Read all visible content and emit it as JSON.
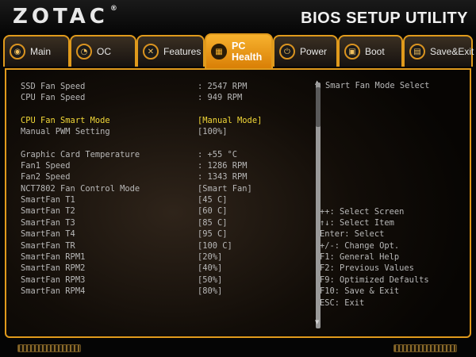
{
  "header": {
    "logo": "ZOTAC",
    "logo_mark": "®",
    "title": "BIOS SETUP UTILITY"
  },
  "tabs": [
    {
      "label": "Main",
      "icon": "circle-icon",
      "glyph": "◉"
    },
    {
      "label": "OC",
      "icon": "gauge-icon",
      "glyph": "◔"
    },
    {
      "label": "Features",
      "icon": "tools-icon",
      "glyph": "✕"
    },
    {
      "label": "PC Health",
      "icon": "chip-icon",
      "glyph": "▦",
      "active": true
    },
    {
      "label": "Power",
      "icon": "power-icon",
      "glyph": "⏻"
    },
    {
      "label": "Boot",
      "icon": "lock-icon",
      "glyph": "▣"
    },
    {
      "label": "Save&Exit",
      "icon": "save-exit-icon",
      "glyph": "▤"
    }
  ],
  "settings": [
    {
      "label": "SSD Fan Speed",
      "value": ": 2547 RPM"
    },
    {
      "label": "CPU Fan Speed",
      "value": ": 949 RPM"
    },
    {
      "label": "CPU Fan Smart Mode",
      "value": "[Manual Mode]",
      "selected": true
    },
    {
      "label": "Manual PWM Setting",
      "value": "[100%]"
    },
    {
      "label": "Graphic Card Temperature",
      "value": ": +55 °C"
    },
    {
      "label": "Fan1 Speed",
      "value": ": 1286 RPM"
    },
    {
      "label": "Fan2 Speed",
      "value": ": 1343 RPM"
    },
    {
      "label": "NCT7802 Fan Control Mode",
      "value": "[Smart Fan]"
    },
    {
      "label": "SmartFan T1",
      "value": "[45 C]"
    },
    {
      "label": "SmartFan T2",
      "value": "[60 C]"
    },
    {
      "label": "SmartFan T3",
      "value": "[85 C]"
    },
    {
      "label": "SmartFan T4",
      "value": "[95 C]"
    },
    {
      "label": "SmartFan TR",
      "value": "[100 C]"
    },
    {
      "label": "SmartFan RPM1",
      "value": "[20%]"
    },
    {
      "label": "SmartFan RPM2",
      "value": "[40%]"
    },
    {
      "label": "SmartFan RPM3",
      "value": "[50%]"
    },
    {
      "label": "SmartFan RPM4",
      "value": "[80%]"
    }
  ],
  "help": {
    "title": "Smart Fan  Mode Select",
    "keys": [
      "++: Select Screen",
      "↑↓: Select Item",
      "Enter: Select",
      "+/-: Change Opt.",
      "F1: General Help",
      "F2: Previous Values",
      "F9: Optimized Defaults",
      "F10: Save & Exit",
      "ESC: Exit"
    ]
  },
  "scroll": {
    "up_glyph": "▲",
    "down_glyph": "▼"
  },
  "colors": {
    "accent": "#e09a1c",
    "active_tab": "#f7b22e",
    "selected_text": "#f2d838",
    "text": "#b8b8b8"
  }
}
